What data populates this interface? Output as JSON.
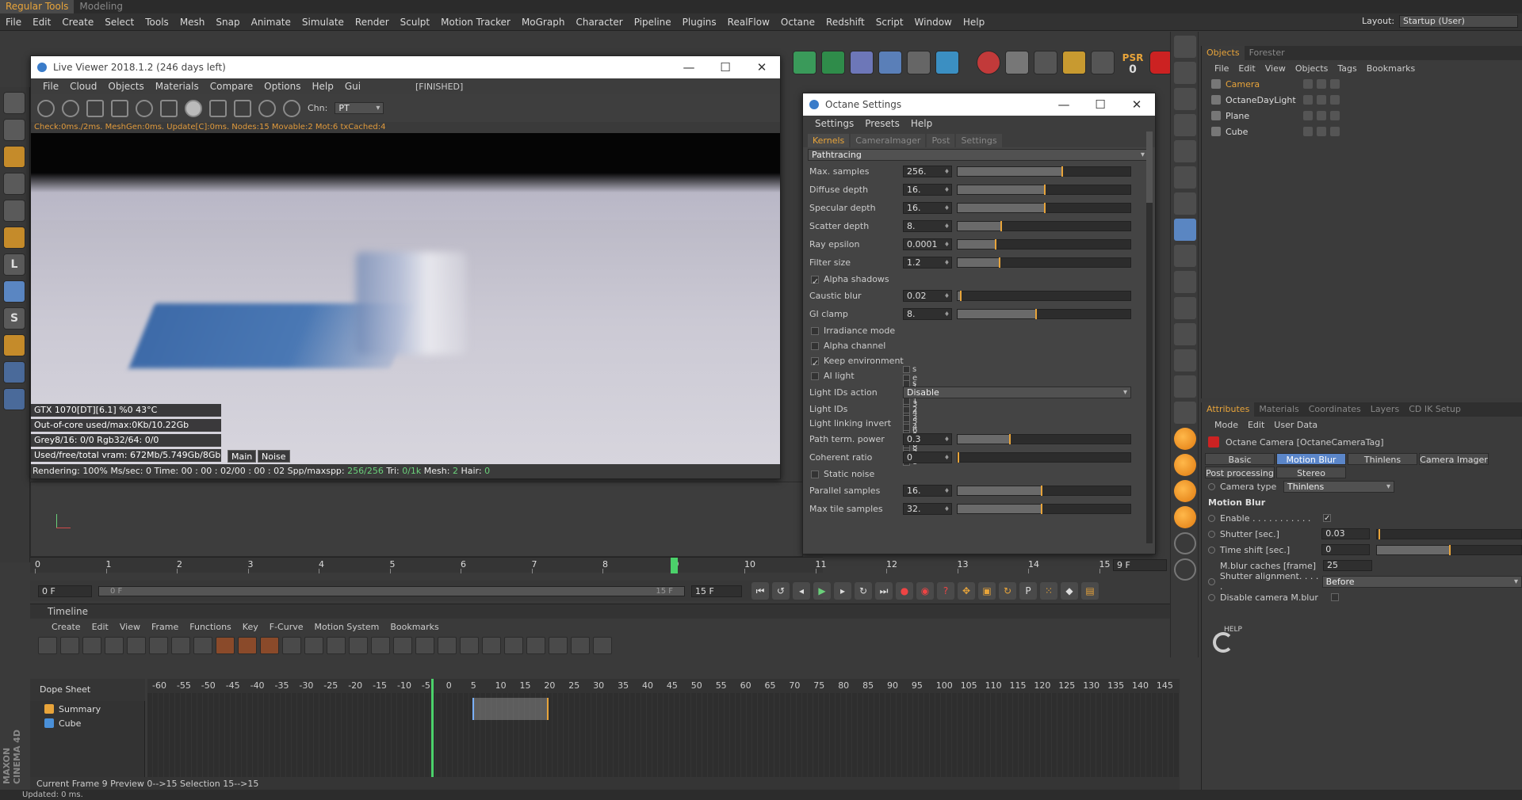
{
  "layout_tabs": [
    "Regular Tools",
    "Modeling"
  ],
  "menu": [
    "File",
    "Edit",
    "Create",
    "Select",
    "Tools",
    "Mesh",
    "Snap",
    "Animate",
    "Simulate",
    "Render",
    "Sculpt",
    "Motion Tracker",
    "MoGraph",
    "Character",
    "Pipeline",
    "Plugins",
    "RealFlow",
    "Octane",
    "Redshift",
    "Script",
    "Window",
    "Help"
  ],
  "layout": {
    "label": "Layout:",
    "value": "Startup (User)"
  },
  "toolbar_psr": {
    "label": "PSR",
    "value": "0"
  },
  "live_viewer": {
    "title": "Live Viewer 2018.1.2 (246 days left)",
    "menu": [
      "File",
      "Cloud",
      "Objects",
      "Materials",
      "Compare",
      "Options",
      "Help",
      "Gui"
    ],
    "finished": "[FINISHED]",
    "chn_label": "Chn:",
    "chn_value": "PT",
    "status": "Check:0ms./2ms. MeshGen:0ms. Update[C]:0ms. Nodes:15 Movable:2 Mot:6 txCached:4",
    "overlays": [
      "GTX 1070[DT][6.1]       %0     43°C",
      "Out-of-core used/max:0Kb/10.22Gb",
      "Grey8/16: 0/0          Rgb32/64: 0/0",
      "Used/free/total vram: 672Mb/5.749Gb/8Gb"
    ],
    "tab_main": "Main",
    "tab_noise": "Noise",
    "render_line": {
      "prefix": "Rendering: 100% Ms/sec: 0   Time: 00 : 00 : 02/00 : 00 : 02  Spp/maxspp: ",
      "spp": "256/256",
      "tri_label": "  Tri: ",
      "tri": "0/1k",
      "mesh_label": "  Mesh: ",
      "mesh": "2",
      "hair_label": "  Hair: ",
      "hair": "0"
    }
  },
  "octane": {
    "title": "Octane Settings",
    "menu": [
      "Settings",
      "Presets",
      "Help"
    ],
    "tabs": [
      "Kernels",
      "CameraImager",
      "Post",
      "Settings"
    ],
    "kernel": "Pathtracing",
    "params": [
      {
        "label": "Max. samples",
        "value": "256.",
        "fill": 0.6
      },
      {
        "label": "Diffuse depth",
        "value": "16.",
        "fill": 0.5
      },
      {
        "label": "Specular depth",
        "value": "16.",
        "fill": 0.5
      },
      {
        "label": "Scatter depth",
        "value": "8.",
        "fill": 0.25
      },
      {
        "label": "Ray epsilon",
        "value": "0.0001",
        "fill": 0.22
      },
      {
        "label": "Filter size",
        "value": "1.2",
        "fill": 0.24
      }
    ],
    "alpha_shadows": "Alpha shadows",
    "params2": [
      {
        "label": "Caustic blur",
        "value": "0.02",
        "fill": 0.02
      },
      {
        "label": "GI clamp",
        "value": "8.",
        "fill": 0.45
      }
    ],
    "irradiance": "Irradiance mode",
    "alpha_channel": "Alpha channel",
    "keep_env": "Keep environment",
    "ai_light": "AI light",
    "light_ids_action": {
      "label": "Light IDs action",
      "value": "Disable"
    },
    "light_ids": {
      "label": "Light IDs",
      "cells": [
        "s",
        "e",
        "1",
        "2",
        "3",
        "4",
        "5",
        "6",
        "7",
        "8"
      ]
    },
    "light_linking": {
      "label": "Light linking invert",
      "cells": [
        "s",
        "e",
        "1",
        "2",
        "3",
        "4",
        "5",
        "6",
        "7",
        "8"
      ]
    },
    "params3": [
      {
        "label": "Path term. power",
        "value": "0.3",
        "fill": 0.3
      },
      {
        "label": "Coherent ratio",
        "value": "0",
        "fill": 0.0
      }
    ],
    "static_noise": "Static noise",
    "params4": [
      {
        "label": "Parallel samples",
        "value": "16.",
        "fill": 0.48
      },
      {
        "label": "Max tile samples",
        "value": "32.",
        "fill": 0.48
      }
    ]
  },
  "timeline_ticks": [
    "0",
    "1",
    "2",
    "3",
    "4",
    "5",
    "6",
    "7",
    "8",
    "9",
    "10",
    "11",
    "12",
    "13",
    "14",
    "15"
  ],
  "current_frame_tick": "9",
  "frame_end_field": "9 F",
  "range": {
    "start": "0 F",
    "slider_start": "0 F",
    "slider_end": "15 F",
    "end": "15 F"
  },
  "timeline": {
    "title": "Timeline",
    "menu": [
      "Create",
      "Edit",
      "View",
      "Frame",
      "Functions",
      "Key",
      "F-Curve",
      "Motion System",
      "Bookmarks"
    ],
    "dope_sheet": "Dope Sheet",
    "ruler": [
      "-60",
      "-55",
      "-50",
      "-45",
      "-40",
      "-35",
      "-30",
      "-25",
      "-20",
      "-15",
      "-10",
      "-5",
      "0",
      "5",
      "10",
      "15",
      "20",
      "25",
      "30",
      "35",
      "40",
      "45",
      "50",
      "55",
      "60",
      "65",
      "70",
      "75",
      "80",
      "85",
      "90",
      "95",
      "100",
      "105",
      "110",
      "115",
      "120",
      "125",
      "130",
      "135",
      "140",
      "145"
    ],
    "tracks": [
      "Summary",
      "Cube"
    ],
    "footer": "Current Frame  9  Preview  0-->15    Selection 15-->15"
  },
  "maxon": "MAXON CINEMA 4D",
  "objects_panel": {
    "tabs": [
      "Objects",
      "Forester"
    ],
    "menu": [
      "File",
      "Edit",
      "View",
      "Objects",
      "Tags",
      "Bookmarks"
    ],
    "items": [
      {
        "name": "Camera",
        "color": "#e8a43a"
      },
      {
        "name": "OctaneDayLight",
        "color": "#dddddd"
      },
      {
        "name": "Plane",
        "color": "#dddddd"
      },
      {
        "name": "Cube",
        "color": "#dddddd"
      }
    ]
  },
  "attributes_panel": {
    "tabs": [
      "Attributes",
      "Materials",
      "Coordinates",
      "Layers",
      "CD IK Setup"
    ],
    "menu": [
      "Mode",
      "Edit",
      "User Data"
    ],
    "object_title": "Octane Camera [OctaneCameraTag]",
    "buttons_row1": [
      "Basic",
      "Motion Blur",
      "Thinlens",
      "Camera Imager"
    ],
    "buttons_row2": [
      "Post processing",
      "Stereo"
    ],
    "camera_type": {
      "label": "Camera type",
      "value": "Thinlens"
    },
    "section": "Motion Blur",
    "enable": "Enable . . . . . . . . . . .",
    "shutter": {
      "label": "Shutter [sec.]",
      "value": "0.03"
    },
    "time_shift": {
      "label": "Time shift [sec.]",
      "value": "0"
    },
    "mblur_caches": {
      "label": "M.blur caches [frame]",
      "value": "25"
    },
    "shutter_alignment": {
      "label": "Shutter alignment. . . . .",
      "value": "Before"
    },
    "disable_mblur": "Disable camera M.blur",
    "help": "HELP"
  },
  "status": "Updated: 0 ms."
}
